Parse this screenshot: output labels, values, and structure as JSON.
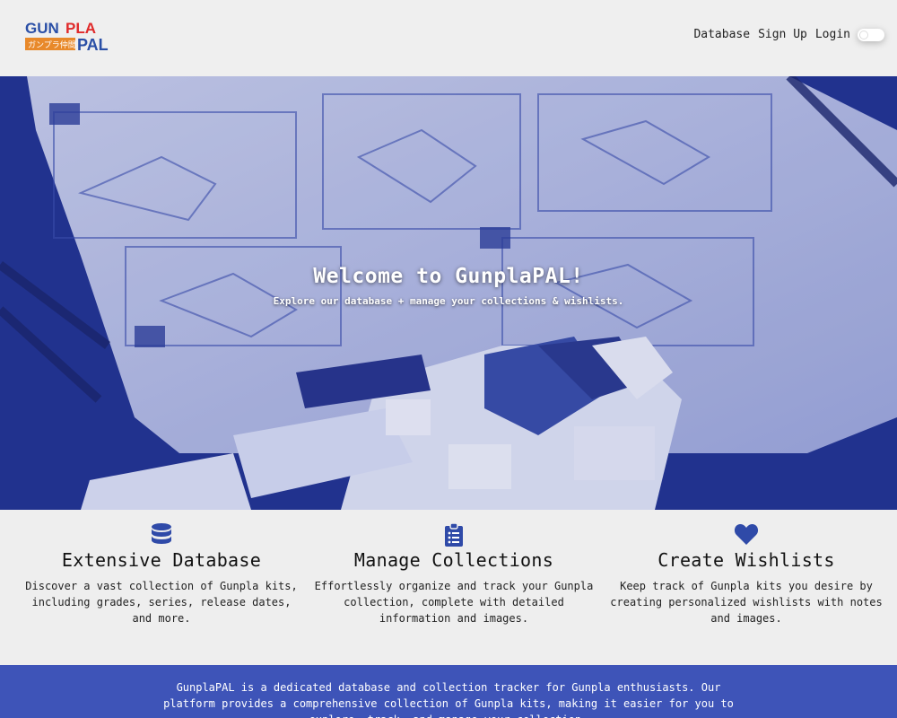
{
  "brand": {
    "line1_a": "GUN",
    "line1_b": "PLA",
    "jp": "ガンプラ仲間",
    "line2": "PAL"
  },
  "nav": {
    "items": [
      "Database",
      "Sign Up",
      "Login"
    ]
  },
  "hero": {
    "title": "Welcome to GunplaPAL!",
    "subtitle": "Explore our database + manage your collections & wishlists."
  },
  "features": [
    {
      "icon": "database-icon",
      "title": "Extensive Database",
      "description": "Discover a vast collection of Gunpla kits, including grades, series, release dates, and more."
    },
    {
      "icon": "clipboard-list-icon",
      "title": "Manage Collections",
      "description": "Effortlessly organize and track your Gunpla collection, complete with detailed information and images."
    },
    {
      "icon": "heart-icon",
      "title": "Create Wishlists",
      "description": "Keep track of Gunpla kits you desire by creating personalized wishlists with notes and images."
    }
  ],
  "footer": {
    "about": "GunplaPAL is a dedicated database and collection tracker for Gunpla enthusiasts. Our platform provides a comprehensive collection of Gunpla kits, making it easier for you to explore, track, and manage your collection."
  },
  "colors": {
    "accent": "#2f4aa8",
    "footer_bg": "#3e54b8",
    "logo_blue": "#2a4fa6",
    "logo_red": "#e02a2a",
    "logo_orange": "#e8892a"
  }
}
